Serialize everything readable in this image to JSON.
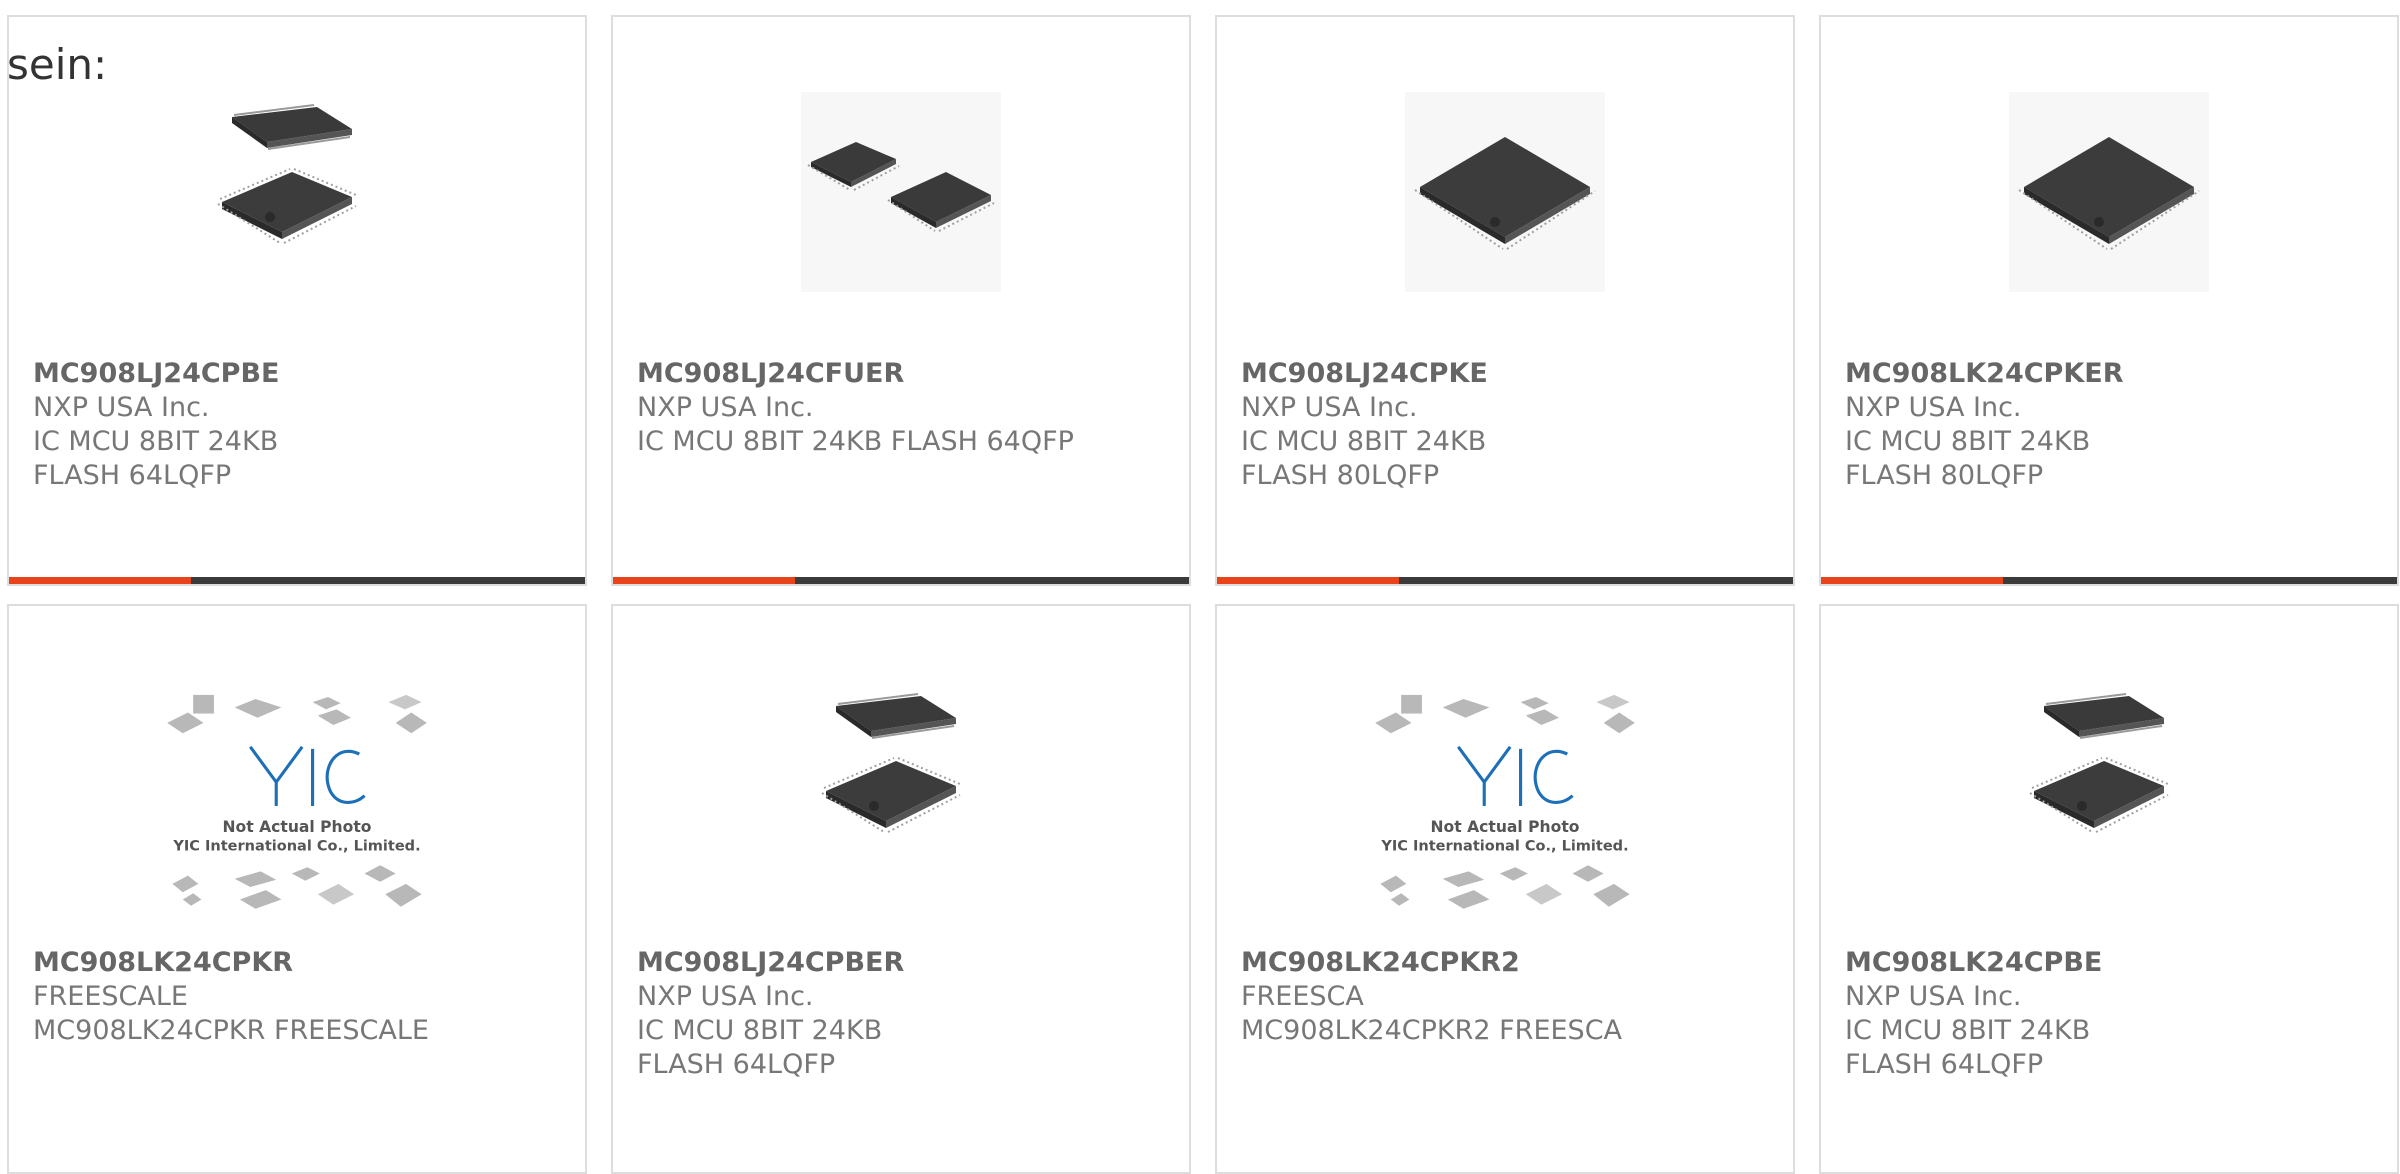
{
  "page_label": "sein:",
  "colors": {
    "accent": "#e8431b",
    "bar": "#3b3b3b",
    "border": "#dddddd",
    "text": "#666666"
  },
  "products": [
    {
      "part_number": "MC908LJ24CPBE",
      "manufacturer": "NXP USA Inc.",
      "description": "IC MCU 8BIT 24KB FLASH 64LQFP",
      "image": "chip-pair-stacked-icon"
    },
    {
      "part_number": "MC908LJ24CFUER",
      "manufacturer": "NXP USA Inc.",
      "description": "IC MCU 8BIT 24KB FLASH 64QFP",
      "image": "chip-pair-side-icon"
    },
    {
      "part_number": "MC908LJ24CPKE",
      "manufacturer": "NXP USA Inc.",
      "description": "IC MCU 8BIT 24KB FLASH 80LQFP",
      "image": "chip-single-icon"
    },
    {
      "part_number": "MC908LK24CPKER",
      "manufacturer": "NXP USA Inc.",
      "description": "IC MCU 8BIT 24KB FLASH 80LQFP",
      "image": "chip-single-icon"
    },
    {
      "part_number": "MC908LK24CPKR",
      "manufacturer": "FREESCALE",
      "description": "MC908LK24CPKR FREESCALE",
      "image": "placeholder-logo-icon",
      "placeholder_text_1": "Not Actual Photo",
      "placeholder_text_2": "YIC International Co., Limited."
    },
    {
      "part_number": "MC908LJ24CPBER",
      "manufacturer": "NXP USA Inc.",
      "description": "IC MCU 8BIT 24KB FLASH 64LQFP",
      "image": "chip-pair-stacked-icon"
    },
    {
      "part_number": "MC908LK24CPKR2",
      "manufacturer": "FREESCA",
      "description": "MC908LK24CPKR2 FREESCA",
      "image": "placeholder-logo-icon",
      "placeholder_text_1": "Not Actual Photo",
      "placeholder_text_2": "YIC International Co., Limited."
    },
    {
      "part_number": "MC908LK24CPBE",
      "manufacturer": "NXP USA Inc.",
      "description": "IC MCU 8BIT 24KB FLASH 64LQFP",
      "image": "chip-pair-stacked-icon"
    }
  ]
}
